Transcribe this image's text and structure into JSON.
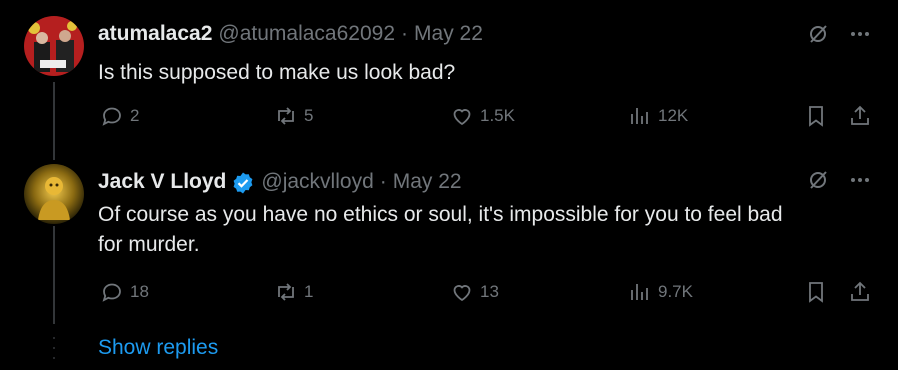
{
  "tweets": [
    {
      "name": "atumalaca2",
      "handle": "@atumalaca62092",
      "separator": "·",
      "date": "May 22",
      "verified": false,
      "text": "Is this supposed to make us look bad?",
      "reply_count": "2",
      "retweet_count": "5",
      "like_count": "1.5K",
      "view_count": "12K"
    },
    {
      "name": "Jack V Lloyd",
      "handle": "@jackvlloyd",
      "separator": "·",
      "date": "May 22",
      "verified": true,
      "text_line1": "Of course as you have no ethics or soul, it's impossible for you to feel bad",
      "text_line2": "for murder.",
      "reply_count": "18",
      "retweet_count": "1",
      "like_count": "13",
      "view_count": "9.7K"
    }
  ],
  "show_replies_label": "Show replies",
  "colors": {
    "background": "#000000",
    "text": "#e7e9ea",
    "muted": "#71767b",
    "link": "#1d9bf0",
    "verified": "#1d9bf0"
  },
  "icons": [
    "reply-icon",
    "retweet-icon",
    "like-icon",
    "views-icon",
    "bookmark-icon",
    "share-icon",
    "grok-icon",
    "more-icon",
    "verified-badge-icon"
  ]
}
